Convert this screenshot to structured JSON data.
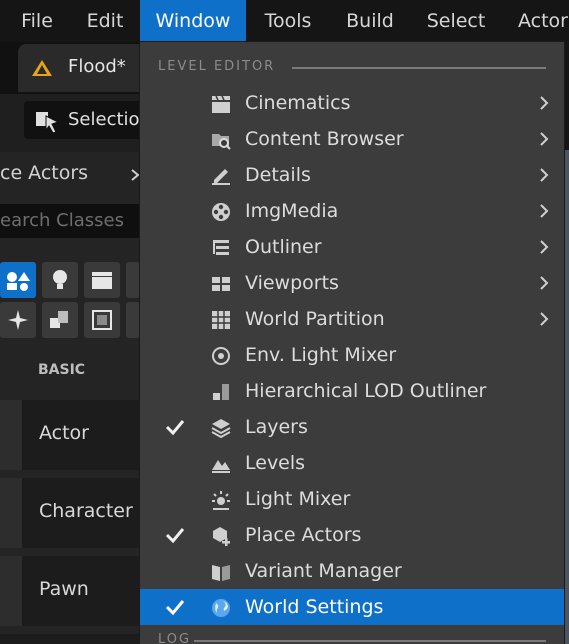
{
  "menubar": {
    "file": "File",
    "edit": "Edit",
    "window": "Window",
    "tools": "Tools",
    "build": "Build",
    "select": "Select",
    "actor": "Actor"
  },
  "tab": {
    "title": "Flood*"
  },
  "toolbar": {
    "selection_label": "Selection"
  },
  "place_actors": {
    "title": "ce Actors",
    "search_placeholder": "earch Classes",
    "section_label": "BASIC",
    "items": [
      {
        "label": "Actor"
      },
      {
        "label": "Character"
      },
      {
        "label": "Pawn"
      }
    ]
  },
  "window_menu": {
    "section_level_editor": "LEVEL EDITOR",
    "section_log": "LOG",
    "items": [
      {
        "label": "Cinematics",
        "icon": "clapperboard-icon",
        "submenu": true,
        "checked": false
      },
      {
        "label": "Content Browser",
        "icon": "folder-search-icon",
        "submenu": true,
        "checked": false
      },
      {
        "label": "Details",
        "icon": "pencil-list-icon",
        "submenu": true,
        "checked": false
      },
      {
        "label": "ImgMedia",
        "icon": "film-reel-icon",
        "submenu": true,
        "checked": false
      },
      {
        "label": "Outliner",
        "icon": "outliner-list-icon",
        "submenu": true,
        "checked": false
      },
      {
        "label": "Viewports",
        "icon": "viewport-grid-icon",
        "submenu": true,
        "checked": false
      },
      {
        "label": "World Partition",
        "icon": "world-partition-grid-icon",
        "submenu": true,
        "checked": false
      },
      {
        "label": "Env. Light Mixer",
        "icon": "light-mixer-ring-icon",
        "submenu": false,
        "checked": false
      },
      {
        "label": "Hierarchical LOD Outliner",
        "icon": "lod-cubes-icon",
        "submenu": false,
        "checked": false
      },
      {
        "label": "Layers",
        "icon": "layers-icon",
        "submenu": false,
        "checked": true
      },
      {
        "label": "Levels",
        "icon": "levels-mountain-icon",
        "submenu": false,
        "checked": false
      },
      {
        "label": "Light Mixer",
        "icon": "sun-light-icon",
        "submenu": false,
        "checked": false
      },
      {
        "label": "Place Actors",
        "icon": "place-actors-cube-plus-icon",
        "submenu": false,
        "checked": true
      },
      {
        "label": "Variant Manager",
        "icon": "variant-book-icon",
        "submenu": false,
        "checked": false
      },
      {
        "label": "World Settings",
        "icon": "globe-icon",
        "submenu": false,
        "checked": true,
        "highlighted": true
      }
    ]
  },
  "colors": {
    "accent": "#0e70c9",
    "menu_bg": "#3c3c3c",
    "menubar_bg": "#151515"
  }
}
